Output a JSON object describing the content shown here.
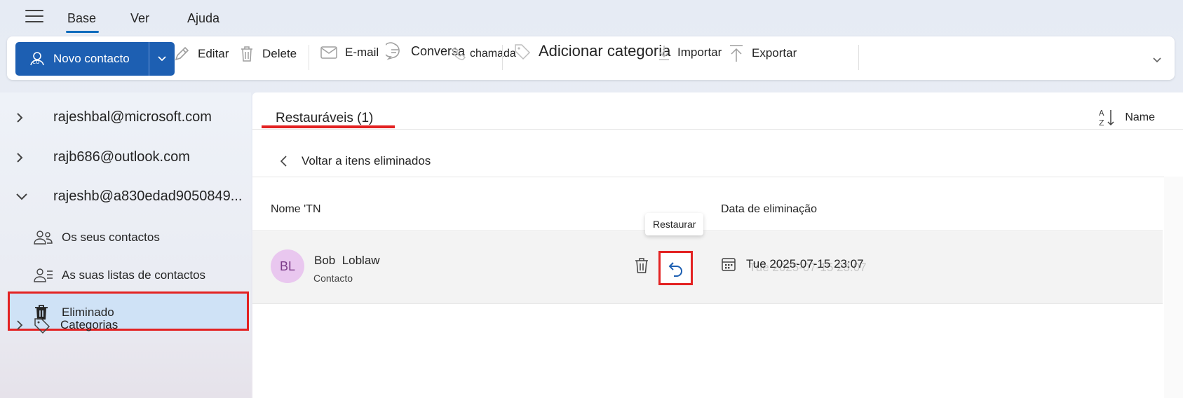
{
  "menu": {
    "tabs": [
      "Base",
      "Ver",
      "Ajuda"
    ],
    "active_tab": "Base"
  },
  "ribbon": {
    "new_contact": "Novo contacto",
    "edit": "Editar",
    "delete": "Delete",
    "email": "E-mail",
    "chat": "Conversa",
    "call": "chamada",
    "add_category": "Adicionar categoria",
    "import": "Importar",
    "export": "Exportar"
  },
  "nav": {
    "accounts": [
      "rajeshbal@microsoft.com",
      "rajb686@outlook.com",
      "rajeshb@a830edad9050849..."
    ],
    "sub_items": [
      "Os seus contactos",
      "As suas listas de contactos",
      "Eliminado"
    ],
    "categories": "Categorias"
  },
  "main": {
    "tab_label": "Restauráveis (1)",
    "sort_label": "Name",
    "back_label": "Voltar a itens eliminados",
    "col_name": "Nome 'TN",
    "col_date": "Data de eliminação",
    "tooltip": "Restaurar",
    "rows": [
      {
        "initials": "BL",
        "name": "Bob  Loblaw",
        "type": "Contacto",
        "date": "Tue 2025-07-15 23:07",
        "date_ghost": "Tue 2025-07-15 23:07"
      }
    ]
  },
  "colors": {
    "accent": "#1d5fb2",
    "highlight": "#e32222",
    "selected": "#cfe2f6",
    "avatar": "#e9c7ef"
  }
}
